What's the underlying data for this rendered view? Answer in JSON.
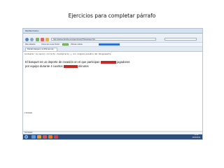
{
  "slide": {
    "title": "Ejercicios para completar párrafo"
  },
  "browser": {
    "window_title": "Mozilla Firefox",
    "menu": [
      "Archivo",
      "Editar",
      "Ver",
      "Historial",
      "Marcadores",
      "Herramientas",
      "Ayuda"
    ],
    "url": "http://elabsenfamilia.com/ejercicios/g7/Tareas/ejer.htm",
    "bookmarks": [
      "Más visitados",
      "Comenzar a usar Firefox",
      "Últimas noticias"
    ],
    "tab_label": "Parrafo basquet y el Pirimero tar..."
  },
  "page": {
    "heading": "Contestar la opción correcta (Cualquiera) y con ninguna palabra del Ninguneante.",
    "sentence_1_a": "El basquet es un deporte de invasión  en el que participan",
    "sentence_1_b": "jugadores",
    "sentence_2_a": "por equipo durante 4 cuartos",
    "sentence_2_b": "minutos",
    "done_text": "ir Estado"
  },
  "status_bar": {
    "text": "Terminado"
  },
  "taskbar": {
    "time": "11:46",
    "date": "22/11/2012"
  },
  "colors": {
    "blank_fill": "#c62828",
    "taskbar": "#2d4d78"
  }
}
